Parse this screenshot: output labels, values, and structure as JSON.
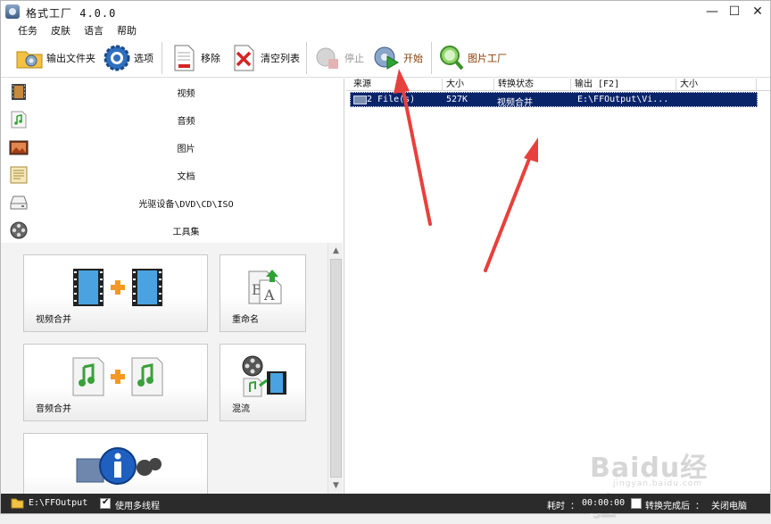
{
  "window": {
    "title": "格式工厂 4.0.0",
    "min": "—",
    "max": "☐",
    "close": "✕"
  },
  "menu": [
    "任务",
    "皮肤",
    "语言",
    "帮助"
  ],
  "toolbar": {
    "output_folder": "输出文件夹",
    "options": "选项",
    "remove": "移除",
    "clear_list": "清空列表",
    "stop": "停止",
    "start": "开始",
    "picture_factory": "图片工厂"
  },
  "categories": [
    "视频",
    "音频",
    "图片",
    "文档",
    "光驱设备\\DVD\\CD\\ISO",
    "工具集"
  ],
  "tools": [
    {
      "label": "视频合并"
    },
    {
      "label": "重命名"
    },
    {
      "label": "音频合并"
    },
    {
      "label": "混流"
    },
    {
      "label": ""
    }
  ],
  "grid": {
    "headers": [
      "来源",
      "大小",
      "转换状态",
      "输出 [F2]",
      "大小"
    ],
    "rows": [
      {
        "source": "2 File(s)",
        "size": "527K",
        "status": "视频合并",
        "output": "E:\\FFOutput\\Vi...",
        "out_size": ""
      }
    ]
  },
  "status": {
    "path": "E:\\FFOutput",
    "multithread": "使用多线程",
    "multithread_checked": true,
    "elapsed_label": "耗时 ：",
    "elapsed": "00:00:00",
    "after_done": "转换完成后 ：",
    "after_done_checked": false,
    "action": "关闭电脑"
  },
  "watermark": {
    "text": "Baidu经验",
    "url": "jingyan.baidu.com"
  },
  "colors": {
    "selection": "#0a246a",
    "annotation": "#e8403c",
    "statusbar": "#2b2b2b",
    "accent": "#8b3d00"
  }
}
